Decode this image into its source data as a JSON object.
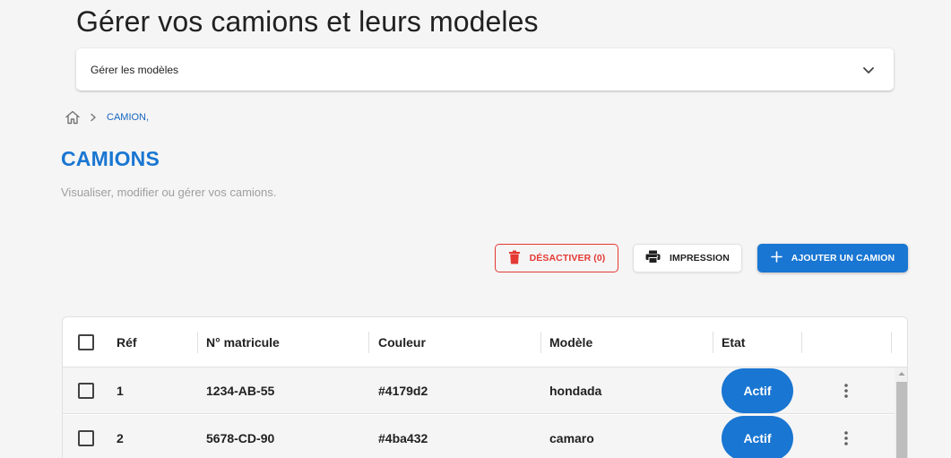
{
  "page": {
    "title": "Gérer vos camions et leurs modeles"
  },
  "accordion": {
    "label": "Gérer les modèles"
  },
  "breadcrumb": {
    "current": "CAMION,"
  },
  "section": {
    "title": "CAMIONS",
    "subtitle": "Visualiser, modifier ou gérer vos camions."
  },
  "actions": {
    "deactivate_label": "DÉSACTIVER (0)",
    "print_label": "IMPRESSION",
    "add_label": "AJOUTER UN CAMION"
  },
  "table": {
    "columns": [
      "Réf",
      "N° matricule",
      "Couleur",
      "Modèle",
      "Etat"
    ],
    "rows": [
      {
        "ref": "1",
        "matricule": "1234-AB-55",
        "couleur": "#4179d2",
        "modele": "hondada",
        "etat": "Actif"
      },
      {
        "ref": "2",
        "matricule": "5678-CD-90",
        "couleur": "#4ba432",
        "modele": "camaro",
        "etat": "Actif"
      }
    ]
  },
  "icons": {
    "home": "home-icon",
    "breadcrumb_separator": "chevron-right-icon",
    "accordion": "chevron-down-icon",
    "deactivate": "trash-icon",
    "print": "printer-icon",
    "add": "plus-icon",
    "row_menu": "more-vertical-icon"
  },
  "colors": {
    "primary": "#1976d2",
    "danger": "#e53935",
    "muted": "#9e9e9e"
  }
}
